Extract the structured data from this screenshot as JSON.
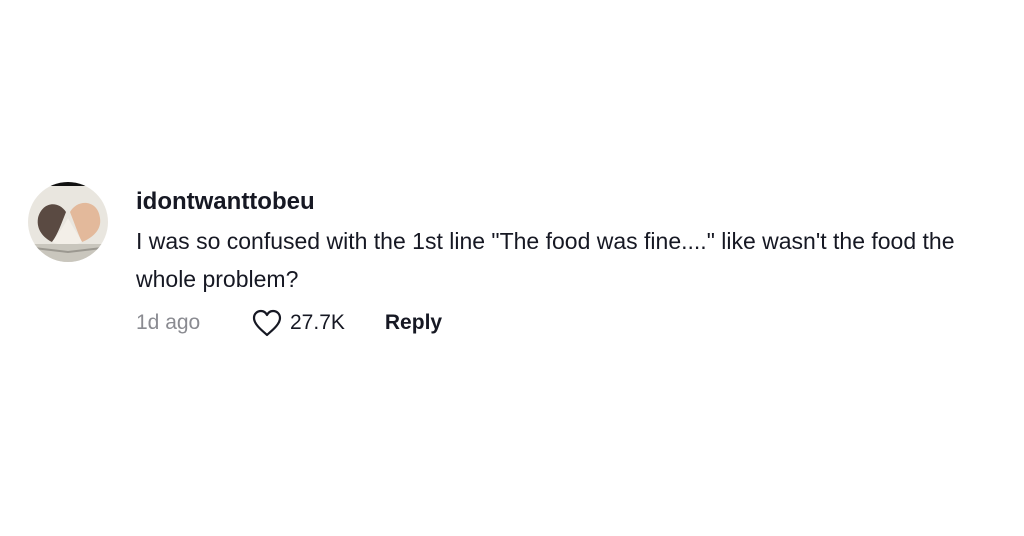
{
  "comment": {
    "username": "idontwanttobeu",
    "text": "I was so confused with the 1st line \"The food was fine....\" like wasn't the food the whole problem?",
    "time": "1d ago",
    "likes": "27.7K",
    "reply_label": "Reply",
    "avatar": "heart-hands-avatar",
    "like_icon": "heart-outline-icon"
  }
}
